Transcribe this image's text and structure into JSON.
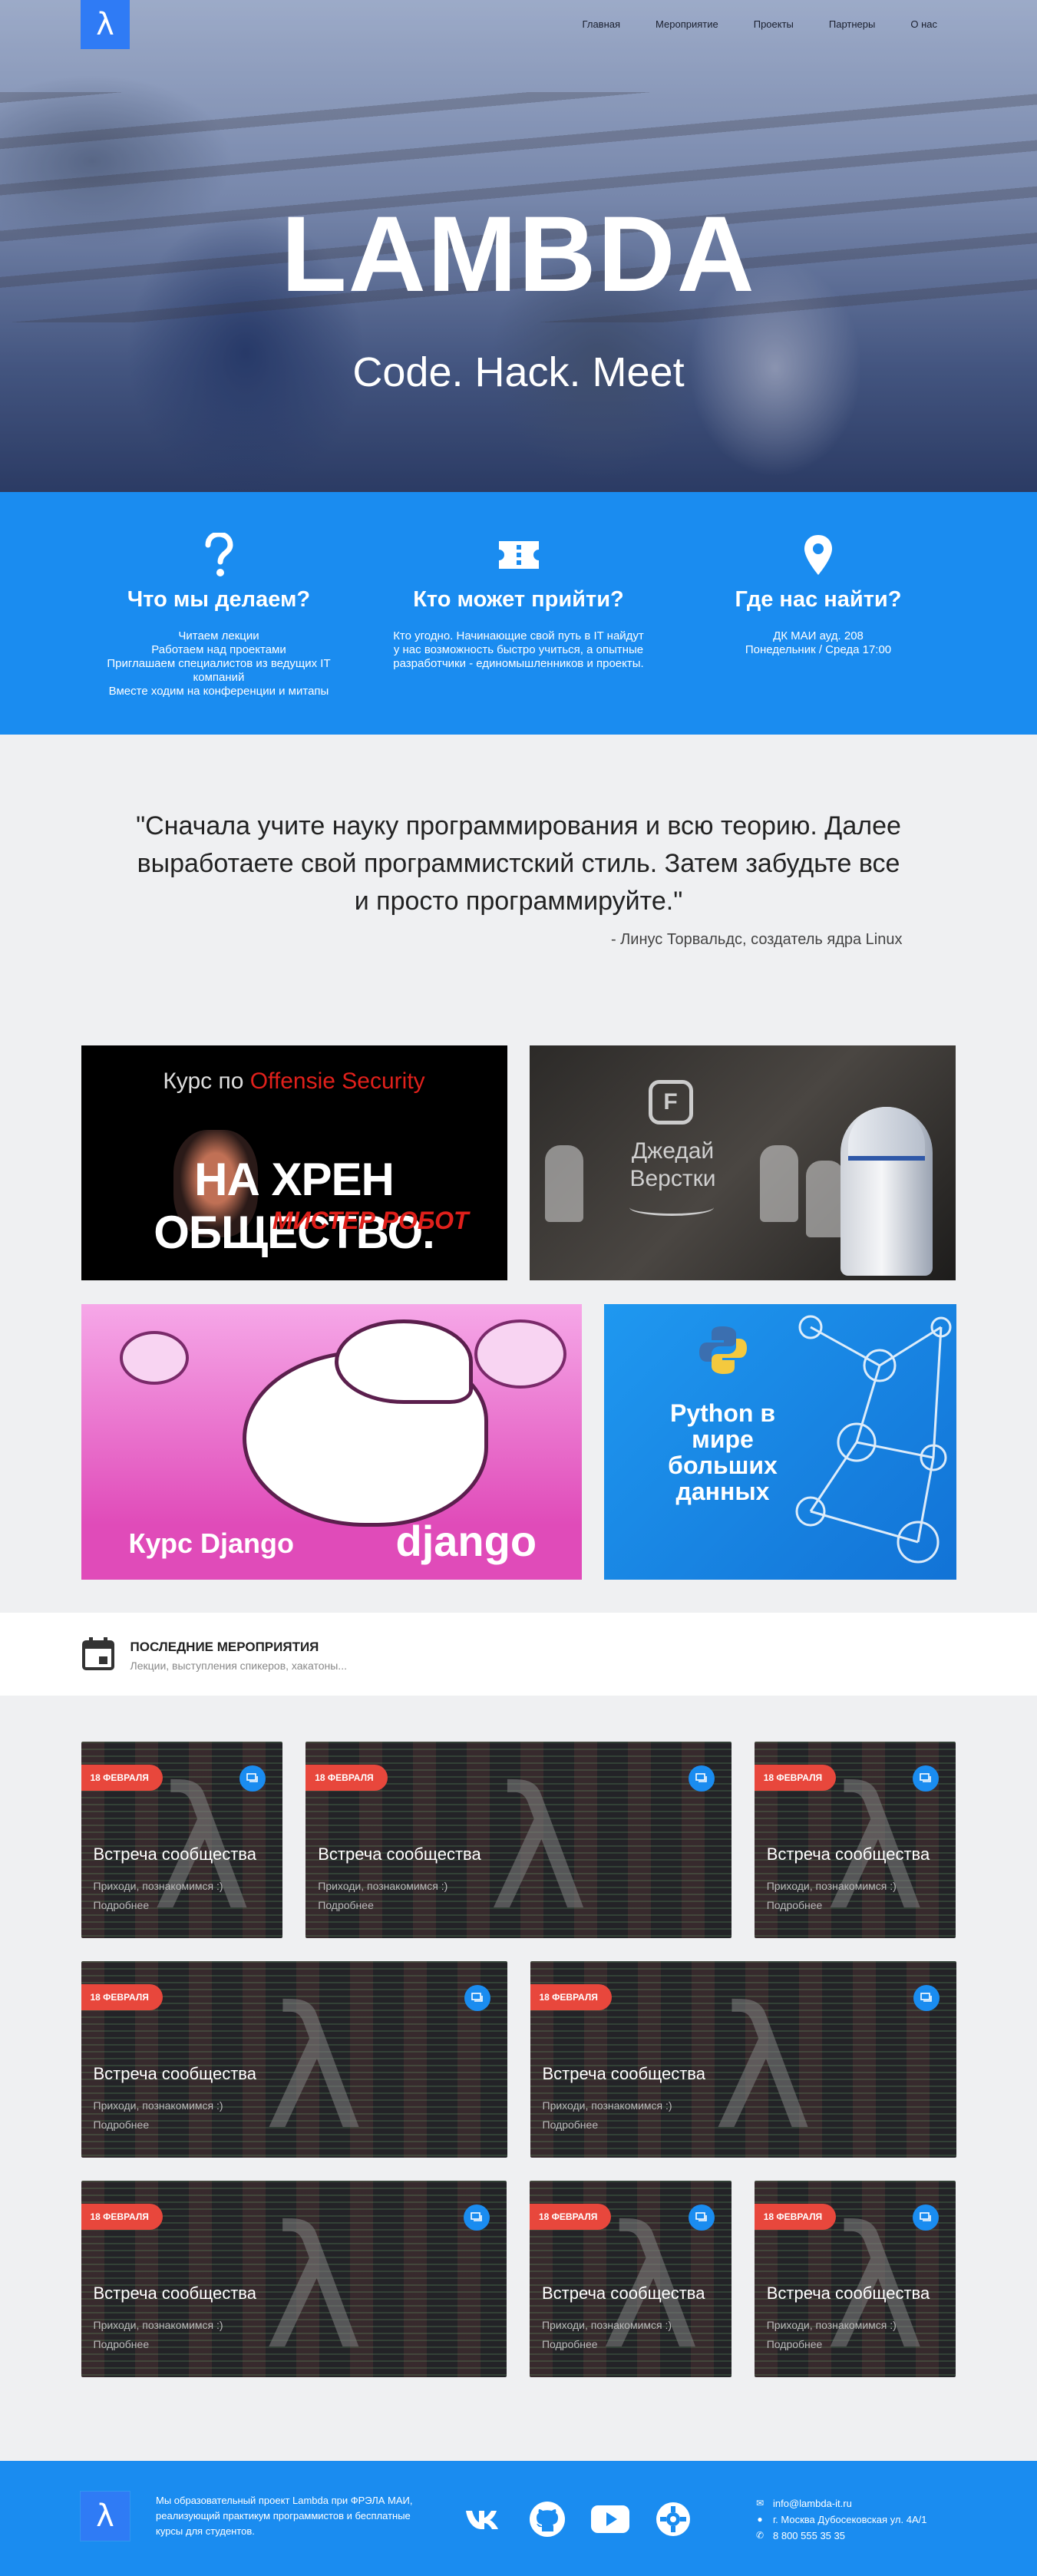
{
  "brand": {
    "logo_glyph": "λ"
  },
  "nav": {
    "items": [
      {
        "label": "Главная"
      },
      {
        "label": "Мероприятие"
      },
      {
        "label": "Проекты"
      },
      {
        "label": "Партнеры"
      },
      {
        "label": "О нас"
      }
    ]
  },
  "hero": {
    "title": "LAMBDA",
    "subtitle": "Code. Hack. Meet"
  },
  "info": [
    {
      "icon": "question-icon",
      "title": "Что мы делаем?",
      "text": "Читаем лекции\nРаботаем над проектами\nПриглашаем специалистов из ведущих IT компаний\nВместе ходим на конференции и митапы"
    },
    {
      "icon": "ticket-icon",
      "title": "Кто может прийти?",
      "text": "Кто угодно. Начинающие свой путь в IT найдут у нас возможность быстро учиться, а опытные разработчики - единомышленников и проекты."
    },
    {
      "icon": "map-pin-icon",
      "title": "Где нас найти?",
      "text": "ДК МАИ ауд. 208\nПонедельник / Среда 17:00"
    }
  ],
  "quote": {
    "text": "\"Сначала учите науку программирования и всю теорию. Далее выработаете свой программистский стиль. Затем забудьте все и просто программируйте.\"",
    "author": "- Линус Торвальдс, создатель ядра Linux"
  },
  "courses": {
    "c1": {
      "prefix": "Курс по ",
      "highlight": "Offensie Security",
      "big": "НА ХРЕН ОБЩЕСТВО.",
      "tag": "МИСТЕР РОБОТ"
    },
    "c2": {
      "title": "Джедай Верстки"
    },
    "c3": {
      "title": "Курс Django",
      "logo": "django"
    },
    "c4": {
      "title": "Python в мире больших данных"
    }
  },
  "events_header": {
    "title": "ПОСЛЕДНИЕ МЕРОПРИЯТИЯ",
    "subtitle": "Лекции, выступления спикеров, хакатоны..."
  },
  "events": [
    {
      "date": "18 ФЕВРАЛЯ",
      "title": "Встреча сообщества",
      "desc": "Приходи, познакомимся :)",
      "more": "Подробнее"
    },
    {
      "date": "18 ФЕВРАЛЯ",
      "title": "Встреча сообщества",
      "desc": "Приходи, познакомимся :)",
      "more": "Подробнее"
    },
    {
      "date": "18 ФЕВРАЛЯ",
      "title": "Встреча сообщества",
      "desc": "Приходи, познакомимся :)",
      "more": "Подробнее"
    },
    {
      "date": "18 ФЕВРАЛЯ",
      "title": "Встреча сообщества",
      "desc": "Приходи, познакомимся :)",
      "more": "Подробнее"
    },
    {
      "date": "18 ФЕВРАЛЯ",
      "title": "Встреча сообщества",
      "desc": "Приходи, познакомимся :)",
      "more": "Подробнее"
    },
    {
      "date": "18 ФЕВРАЛЯ",
      "title": "Встреча сообщества",
      "desc": "Приходи, познакомимся :)",
      "more": "Подробнее"
    },
    {
      "date": "18 ФЕВРАЛЯ",
      "title": "Встреча сообщества",
      "desc": "Приходи, познакомимся :)",
      "more": "Подробнее"
    },
    {
      "date": "18 ФЕВРАЛЯ",
      "title": "Встреча сообщества",
      "desc": "Приходи, познакомимся :)",
      "more": "Подробнее"
    }
  ],
  "footer": {
    "text": "Мы образовательный проект Lambda при ФРЭЛА МАИ, реализующий практикум программистов и бесплатные курсы для студентов.",
    "socials": [
      "vk-icon",
      "github-icon",
      "youtube-icon",
      "gear-icon"
    ],
    "email": "info@lambda-it.ru",
    "address": "г. Москва Дубосековская ул. 4А/1",
    "phone": "8 800 555 35 35"
  },
  "colors": {
    "primary": "#1a8cf0",
    "logo_bg": "#2f7bf5",
    "badge": "#e8473c",
    "background": "#eff0f2"
  }
}
